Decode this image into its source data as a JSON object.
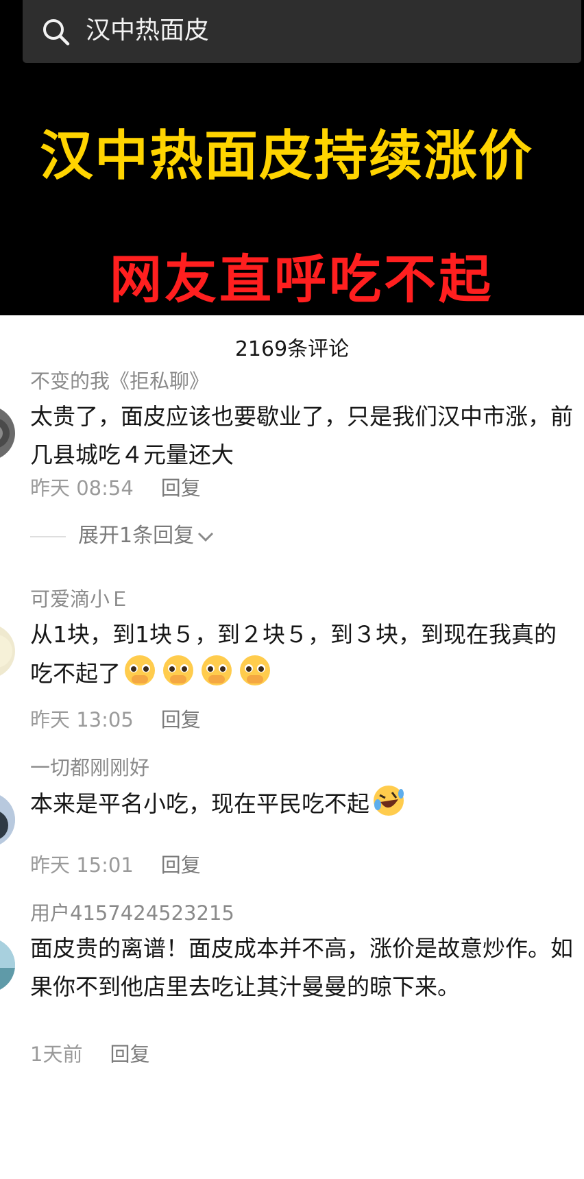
{
  "search": {
    "query": "汉中热面皮"
  },
  "video": {
    "headline": "汉中热面皮持续涨价",
    "subline": "网友直呼吃不起"
  },
  "comments_header": {
    "count_label": "2169条评论"
  },
  "comments": [
    {
      "user": "不变的我《拒私聊》",
      "text": "太贵了，面皮应该也要歇业了，只是我们汉中市涨，前几县城吃４元量还大",
      "time": "昨天 08:54",
      "reply": "回复",
      "expand": "展开1条回复"
    },
    {
      "user": "可爱滴小Ｅ",
      "text": "从1块，到1块５，到２块５，到３块，到现在我真的吃不起了",
      "time": "昨天 13:05",
      "reply": "回复"
    },
    {
      "user": "一切都刚刚好",
      "text": "本来是平名小吃，现在平民吃不起",
      "time": "昨天 15:01",
      "reply": "回复"
    },
    {
      "user": "用户4157424523215",
      "text": "面皮贵的离谱！面皮成本并不高，涨价是故意炒作。如果你不到他店里去吃让其汁曼曼的晾下来。",
      "time": "1天前",
      "reply": "回复"
    }
  ],
  "icons": {
    "search": "search-icon",
    "expand": "chevron-down-icon",
    "pleading_emoji": "pleading-face-emoji",
    "laughing_emoji": "rolling-laughing-emoji"
  },
  "colors": {
    "headline": "#ffd400",
    "subline": "#ff1f1f",
    "search_bg": "#2e2e2e"
  }
}
